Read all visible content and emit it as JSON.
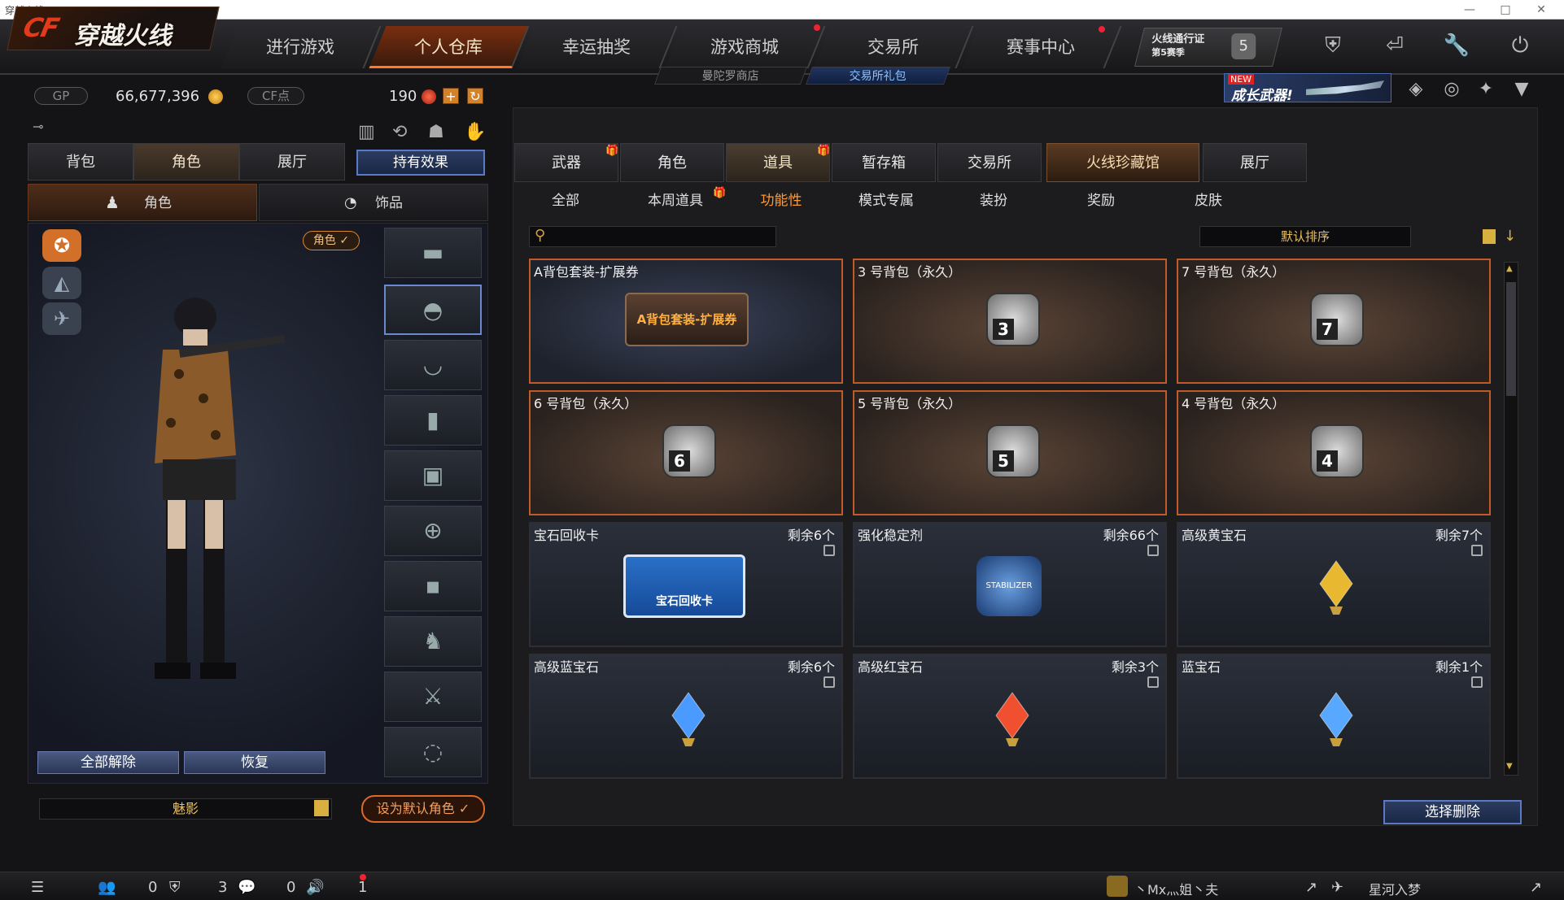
{
  "window": {
    "title": "穿越火线"
  },
  "nav": {
    "logo": "穿越火线",
    "logo_mark": "CF",
    "tabs": [
      "进行游戏",
      "个人仓库",
      "幸运抽奖",
      "游戏商城",
      "交易所",
      "赛事中心"
    ],
    "active": "个人仓库",
    "subtabs": [
      "曼陀罗商店",
      "交易所礼包"
    ],
    "pass_badge_line1": "火线通行证",
    "pass_badge_line2": "第5赛季",
    "pass_level": "5",
    "banner_new": "NEW",
    "banner_text": "成长武器!"
  },
  "currency": {
    "gp_label": "GP",
    "gp_value": "66,677,396",
    "cf_label": "CF点",
    "cf_value": "190"
  },
  "left": {
    "tabs": [
      "背包",
      "角色",
      "展厅"
    ],
    "active_tab": "角色",
    "effect_button": "持有效果",
    "subtabs": [
      "角色",
      "饰品"
    ],
    "role_tag": "角色 ✓",
    "unequip_all": "全部解除",
    "restore": "恢复",
    "character_name": "魅影",
    "set_default": "设为默认角色 ✓"
  },
  "right": {
    "category_tabs": [
      "武器",
      "角色",
      "道具",
      "暂存箱",
      "交易所",
      "火线珍藏馆",
      "展厅"
    ],
    "active_category": "道具",
    "filters": [
      "全部",
      "本周道具",
      "功能性",
      "模式专属",
      "装扮",
      "奖励",
      "皮肤"
    ],
    "active_filter": "功能性",
    "sort": "默认排序",
    "delete_button": "选择删除",
    "items": [
      {
        "name": "A背包套装-扩展券",
        "count": "",
        "style": "voucher",
        "label": "A背包套装-扩展券"
      },
      {
        "name": "3 号背包（永久）",
        "count": "",
        "style": "bag",
        "num": "3"
      },
      {
        "name": "7 号背包（永久）",
        "count": "",
        "style": "bag",
        "num": "7"
      },
      {
        "name": "6 号背包（永久）",
        "count": "",
        "style": "bag",
        "num": "6"
      },
      {
        "name": "5 号背包（永久）",
        "count": "",
        "style": "bag",
        "num": "5"
      },
      {
        "name": "4 号背包（永久）",
        "count": "",
        "style": "bag",
        "num": "4"
      },
      {
        "name": "宝石回收卡",
        "count": "剩余6个",
        "style": "card",
        "label": "宝石回收卡"
      },
      {
        "name": "强化稳定剂",
        "count": "剩余66个",
        "style": "stabilizer",
        "label": "STABILIZER"
      },
      {
        "name": "高级黄宝石",
        "count": "剩余7个",
        "style": "gem",
        "color": "#e8b830"
      },
      {
        "name": "高级蓝宝石",
        "count": "剩余6个",
        "style": "gem",
        "color": "#4a9aff"
      },
      {
        "name": "高级红宝石",
        "count": "剩余3个",
        "style": "gem",
        "color": "#f05030"
      },
      {
        "name": "蓝宝石",
        "count": "剩余1个",
        "style": "gem",
        "color": "#58a8ff"
      }
    ]
  },
  "bottom": {
    "counts": [
      "0",
      "3",
      "0",
      "1"
    ],
    "chat_user": "丶Mx灬姐丶夫",
    "friend": "星河入梦"
  },
  "colors": {
    "accent": "#ff7a2a",
    "orange_border": "#c05a28",
    "blue_button": "#5a7ac8"
  }
}
